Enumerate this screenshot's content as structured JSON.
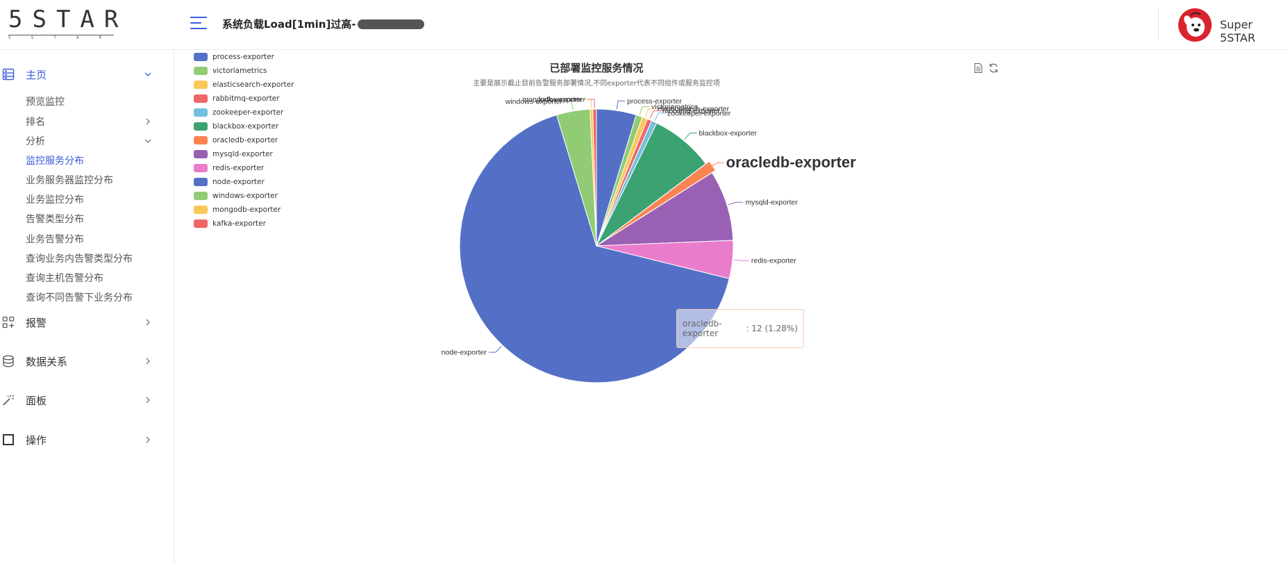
{
  "header": {
    "logo_main": "5STAR",
    "logo_sub": "5STAR",
    "alert_text": "系统负载Load[1min]过高-",
    "user_name": "Super 5STAR"
  },
  "sidebar": {
    "home": {
      "label": "主页",
      "icon": "dashboard-icon"
    },
    "home_items": [
      {
        "label": "预览监控"
      },
      {
        "label": "排名"
      },
      {
        "label": "分析"
      },
      {
        "label": "监控服务分布"
      },
      {
        "label": "业务服务器监控分布"
      },
      {
        "label": "业务监控分布"
      },
      {
        "label": "告警类型分布"
      },
      {
        "label": "业务告警分布"
      },
      {
        "label": "查询业务内告警类型分布"
      },
      {
        "label": "查询主机告警分布"
      },
      {
        "label": "查询不同告警下业务分布"
      }
    ],
    "alarm": {
      "label": "报警",
      "icon": "apps-add-icon"
    },
    "data_relation": {
      "label": "数据关系",
      "icon": "database-icon"
    },
    "panel": {
      "label": "面板",
      "icon": "magic-wand-icon"
    },
    "operation": {
      "label": "操作",
      "icon": "square-icon"
    }
  },
  "colors": {
    "accent": "#3b5bdb",
    "tooltip_border": "#f7c9b2"
  },
  "chart_data": {
    "type": "pie",
    "title": "已部署监控服务情况",
    "subtitle": "主要是展示截止目前告警服务部署情况,不同exporter代表不同组件或服务监控项",
    "legend_position": "top-left",
    "categories": [
      "process-exporter",
      "victoriametrics",
      "elasticsearch-exporter",
      "rabbitmq-exporter",
      "zookeeper-exporter",
      "blackbox-exporter",
      "oracledb-exporter",
      "mysqld-exporter",
      "redis-exporter",
      "node-exporter",
      "windows-exporter",
      "mongodb-exporter",
      "kafka-exporter"
    ],
    "values": [
      44,
      7,
      6,
      5,
      6,
      70,
      12,
      78,
      42,
      622,
      37,
      3,
      4
    ],
    "colors": [
      "#5470c6",
      "#91cc75",
      "#fac858",
      "#ee6666",
      "#73c0de",
      "#3ba272",
      "#fc8452",
      "#9a60b4",
      "#ea7ccc",
      "#5470c6",
      "#91cc75",
      "#fac858",
      "#ee6666"
    ],
    "highlighted": "oracledb-exporter",
    "tooltip": {
      "name": "oracledb-exporter",
      "value": "12",
      "percent": "(1.28%)"
    }
  }
}
